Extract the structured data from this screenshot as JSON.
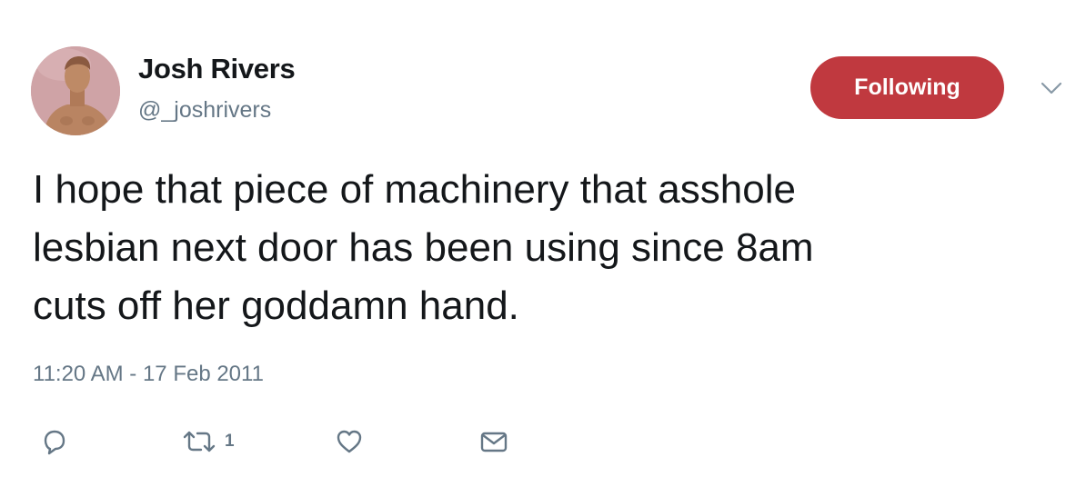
{
  "user": {
    "display_name": "Josh Rivers",
    "handle": "@_joshrivers"
  },
  "follow_button": {
    "label": "Following",
    "color": "#c0393f"
  },
  "tweet": {
    "text": "I hope that piece of machinery that asshole\nlesbian next door has been using since 8am\ncuts off her goddamn hand.",
    "timestamp": "11:20 AM - 17 Feb 2011"
  },
  "actions": {
    "reply_icon": "reply-icon",
    "retweet_icon": "retweet-icon",
    "retweet_count": "1",
    "like_icon": "heart-icon",
    "dm_icon": "envelope-icon"
  },
  "colors": {
    "text_primary": "#14171a",
    "text_secondary": "#657786",
    "avatar_background": "#cfa3a6"
  }
}
